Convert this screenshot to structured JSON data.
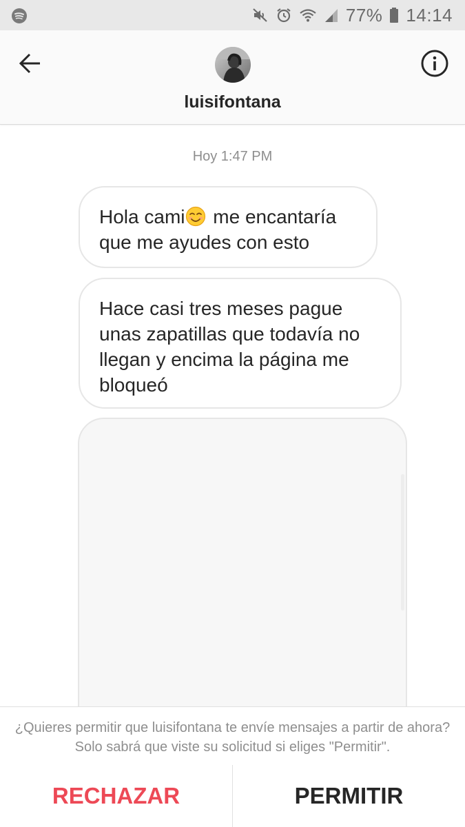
{
  "status_bar": {
    "battery_percent": "77%",
    "time": "14:14",
    "icons": [
      "spotify-icon",
      "mute-icon",
      "alarm-icon",
      "wifi-icon",
      "signal-icon",
      "battery-icon"
    ]
  },
  "header": {
    "username": "luisifontana",
    "back_icon": "arrow-left-icon",
    "info_icon": "info-circle-icon"
  },
  "chat": {
    "timestamp": "Hoy 1:47 PM",
    "messages": [
      {
        "text_before_emoji": "Hola cami",
        "emoji": "smiling-face-icon",
        "text_after_emoji": " me encantaría que me ayudes con esto"
      },
      {
        "text": "Hace casi tres meses pague unas zapatillas que todavía no llegan y encima la página me bloqueó"
      }
    ]
  },
  "request": {
    "prompt": "¿Quieres permitir que luisifontana te envíe mensajes a partir de ahora? Solo sabrá que viste su solicitud si eliges \"Permitir\".",
    "reject_label": "RECHAZAR",
    "allow_label": "PERMITIR"
  },
  "colors": {
    "reject": "#ed4956",
    "text_primary": "#262626",
    "text_secondary": "#8e8e8e",
    "status_bar_bg": "#e8e8e8"
  }
}
